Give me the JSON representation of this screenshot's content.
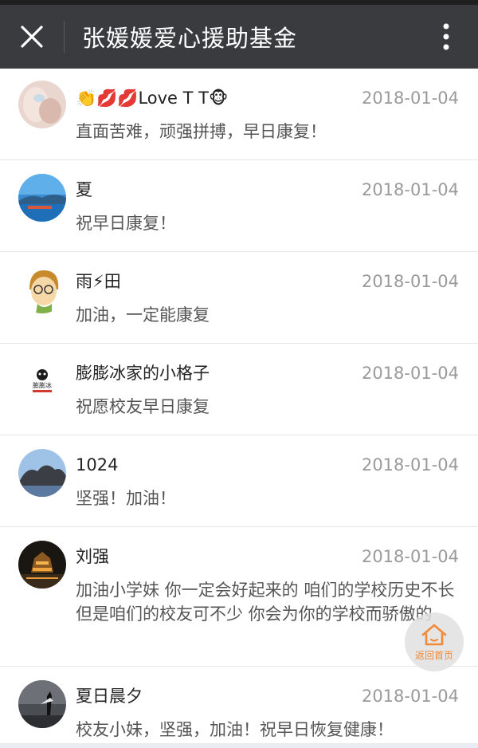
{
  "header": {
    "title": "张媛媛爱心援助基金"
  },
  "comments": [
    {
      "name": "👏💋💋Love T T🐵",
      "date": "2018-01-04",
      "message": "直面苦难，顽强拼搏，早日康复！"
    },
    {
      "name": "夏",
      "date": "2018-01-04",
      "message": "祝早日康复！"
    },
    {
      "name": "雨⚡田",
      "date": "2018-01-04",
      "message": "加油，一定能康复"
    },
    {
      "name": "膨膨冰家的小格子",
      "date": "2018-01-04",
      "message": "祝愿校友早日康复"
    },
    {
      "name": "1024",
      "date": "2018-01-04",
      "message": "坚强！加油！"
    },
    {
      "name": "刘强",
      "date": "2018-01-04",
      "message": "加油小学妹 你一定会好起来的  咱们的学校历史不长 但是咱们的校友可不少  你会为你的学校而骄傲的"
    },
    {
      "name": "夏日晨夕",
      "date": "2018-01-04",
      "message": "校友小妹，坚强，加油！祝早日恢复健康！"
    }
  ],
  "avatar_texts": {
    "shop_logo": "膨膨冰"
  },
  "float_button": {
    "label": "返回首页"
  },
  "colors": {
    "titlebar": "#3a3b3f",
    "accent": "#f08a3a"
  }
}
